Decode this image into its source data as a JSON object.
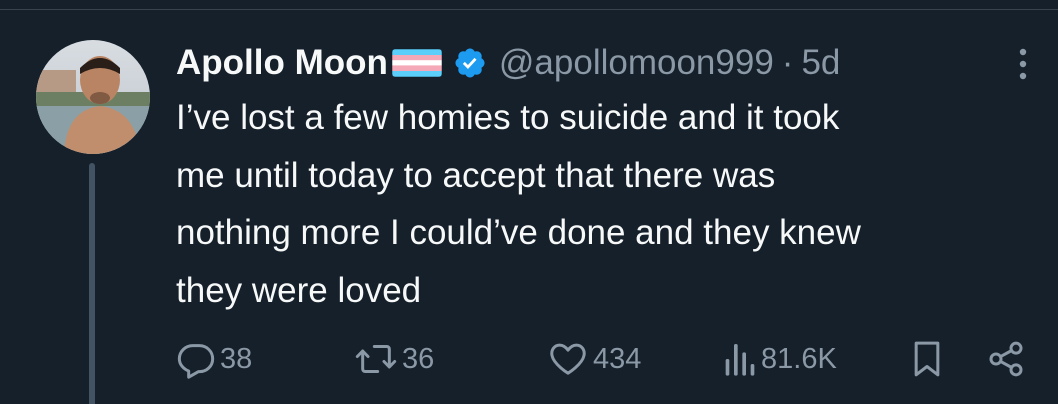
{
  "author": {
    "display_name": "Apollo Moon",
    "handle": "@apollomoon999",
    "separator": "·",
    "timestamp": "5d",
    "verified_badge_color": "#1d9bf0",
    "flag_emoji": "transgender-flag"
  },
  "tweet": {
    "text": "I’ve lost a few homies to suicide and it took\nme until today to accept that there was\nnothing more I could’ve done and they knew\nthey were loved"
  },
  "actions": {
    "replies": "38",
    "reposts": "36",
    "likes": "434",
    "views": "81.6K"
  },
  "icons": {
    "reply": "reply-icon",
    "repost": "repost-icon",
    "like": "heart-icon",
    "views": "views-icon",
    "bookmark": "bookmark-icon",
    "share": "share-icon",
    "more": "more-icon"
  },
  "colors": {
    "background": "#15202b",
    "primary_text": "#f7f9f9",
    "secondary_text": "#8b98a5",
    "divider": "#38444d",
    "thread_line": "#425364",
    "accent": "#1d9bf0"
  }
}
